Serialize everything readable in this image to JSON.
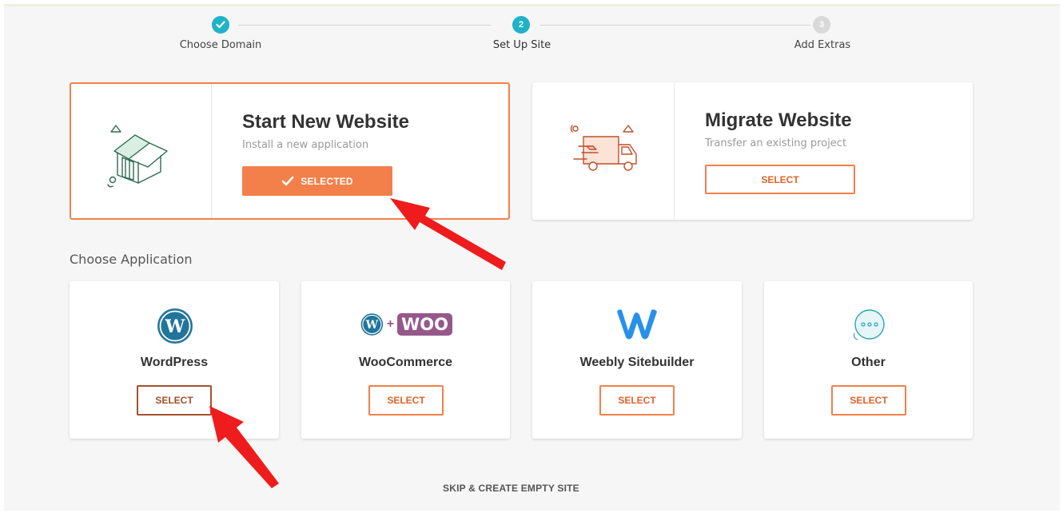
{
  "stepper": {
    "steps": [
      {
        "label": "Choose Domain",
        "number": "",
        "state": "done"
      },
      {
        "label": "Set Up Site",
        "number": "2",
        "state": "active"
      },
      {
        "label": "Add Extras",
        "number": "3",
        "state": "pending"
      }
    ]
  },
  "options": [
    {
      "title": "Start New Website",
      "subtitle": "Install a new application",
      "button": "SELECTED",
      "selected": true
    },
    {
      "title": "Migrate Website",
      "subtitle": "Transfer an existing project",
      "button": "SELECT",
      "selected": false
    }
  ],
  "applications_title": "Choose Application",
  "applications": [
    {
      "name": "WordPress",
      "button": "SELECT"
    },
    {
      "name": "WooCommerce",
      "button": "SELECT",
      "logo_text": "WOO",
      "plus": "+"
    },
    {
      "name": "Weebly Sitebuilder",
      "button": "SELECT"
    },
    {
      "name": "Other",
      "button": "SELECT"
    }
  ],
  "skip_label": "SKIP & CREATE EMPTY SITE",
  "colors": {
    "accent": "#f3804a",
    "step_active": "#1fb3c8",
    "step_pending": "#d9d9d9",
    "wordpress": "#21759b",
    "woo": "#96588a",
    "weebly": "#2990ea",
    "annotation_arrow": "#ee1c1c"
  }
}
